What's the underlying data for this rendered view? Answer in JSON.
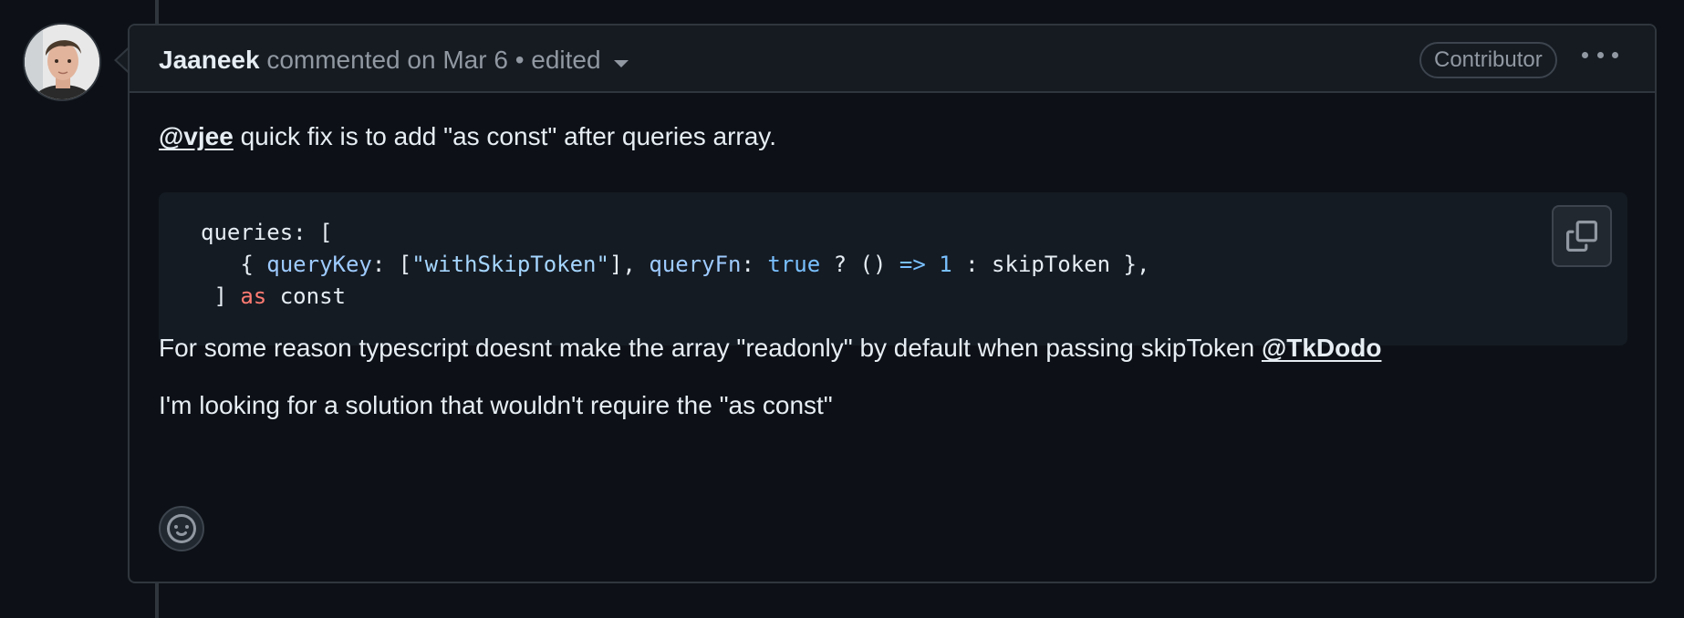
{
  "comment": {
    "author": "Jaaneek",
    "action_text": "commented on Mar 6",
    "separator": "•",
    "edited_label": "edited",
    "role_badge": "Contributor",
    "paragraph1": {
      "mention": "@vjee",
      "text": " quick fix is to add \"as const\" after queries array."
    },
    "code": {
      "line1": "queries: [",
      "line2": {
        "open": "{ ",
        "key1": "queryKey",
        "colon1": ": [",
        "str1": "\"withSkipToken\"",
        "close1": "], ",
        "key2": "queryFn",
        "colon2": ": ",
        "bool": "true",
        "ternary": " ? () ",
        "arrow": "=>",
        "space": " ",
        "num": "1",
        "rest": " : skipToken },"
      },
      "line3": {
        "bracket": "] ",
        "as": "as",
        "rest": " const"
      }
    },
    "paragraph2": {
      "text": "For some reason typescript doesnt make the array \"readonly\" by default when passing skipToken ",
      "mention": "@TkDodo"
    },
    "paragraph3": "I'm looking for a solution that wouldn't require the \"as const\""
  },
  "icons": {
    "more": "kebab-horizontal-icon",
    "copy": "copy-icon",
    "emoji": "smiley-icon",
    "caret": "triangle-down-icon"
  }
}
